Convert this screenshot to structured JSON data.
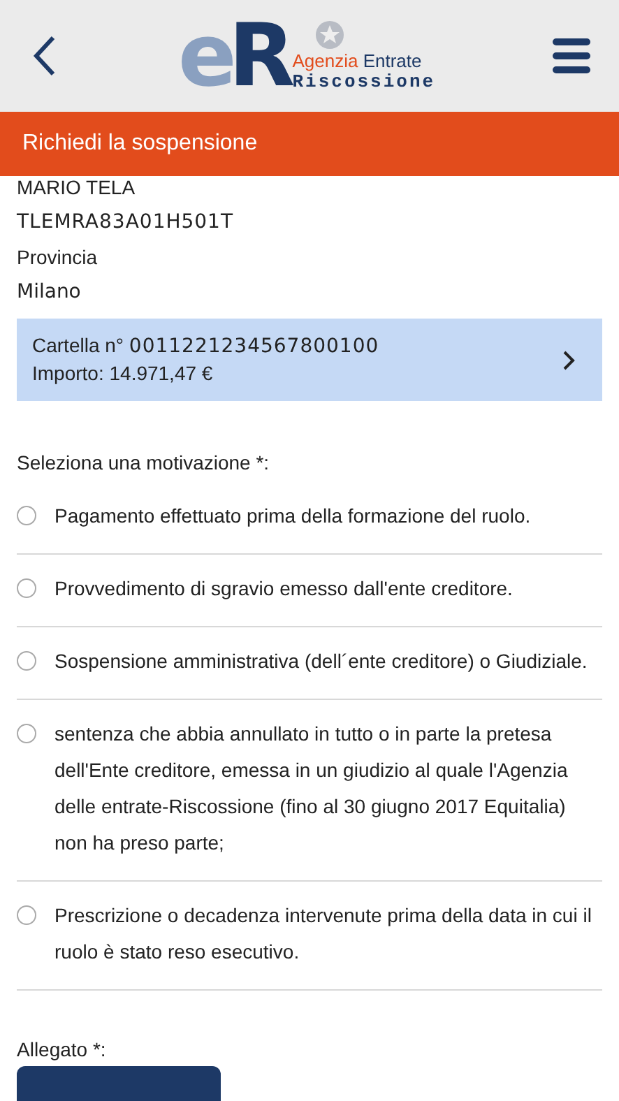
{
  "header": {
    "logo_letters": "eR",
    "logo_line1_a": "Agenzia",
    "logo_line1_b": "Entrate",
    "logo_line2": "Riscossione"
  },
  "title_bar": {
    "title": "Richiedi la sospensione"
  },
  "person": {
    "name": "MARIO TELA",
    "code": "TLEMRA83A01H501T",
    "province_label": "Provincia",
    "province": "Milano"
  },
  "cartella": {
    "label": "Cartella n°",
    "number": "0011221234567800100",
    "amount": "Importo: 14.971,47 €"
  },
  "motivation": {
    "label": "Seleziona una motivazione *:",
    "options": [
      {
        "text": "Pagamento effettuato prima della formazione del ruolo.",
        "selected": false
      },
      {
        "text": "Provvedimento di sgravio emesso dall'ente creditore.",
        "selected": false
      },
      {
        "text": "Sospensione amministrativa (dell´ente creditore) o Giudiziale.",
        "selected": false
      },
      {
        "text": "sentenza che abbia annullato in tutto o in parte la pretesa dell'Ente creditore, emessa in un giudizio al quale l'Agenzia delle entrate-Riscossione (fino al 30 giugno 2017 Equitalia) non ha preso parte;",
        "selected": false
      },
      {
        "text": "Prescrizione o decadenza intervenute prima della data in cui il ruolo è stato reso esecutivo.",
        "selected": false
      }
    ]
  },
  "attachment": {
    "label": "Allegato *:"
  }
}
